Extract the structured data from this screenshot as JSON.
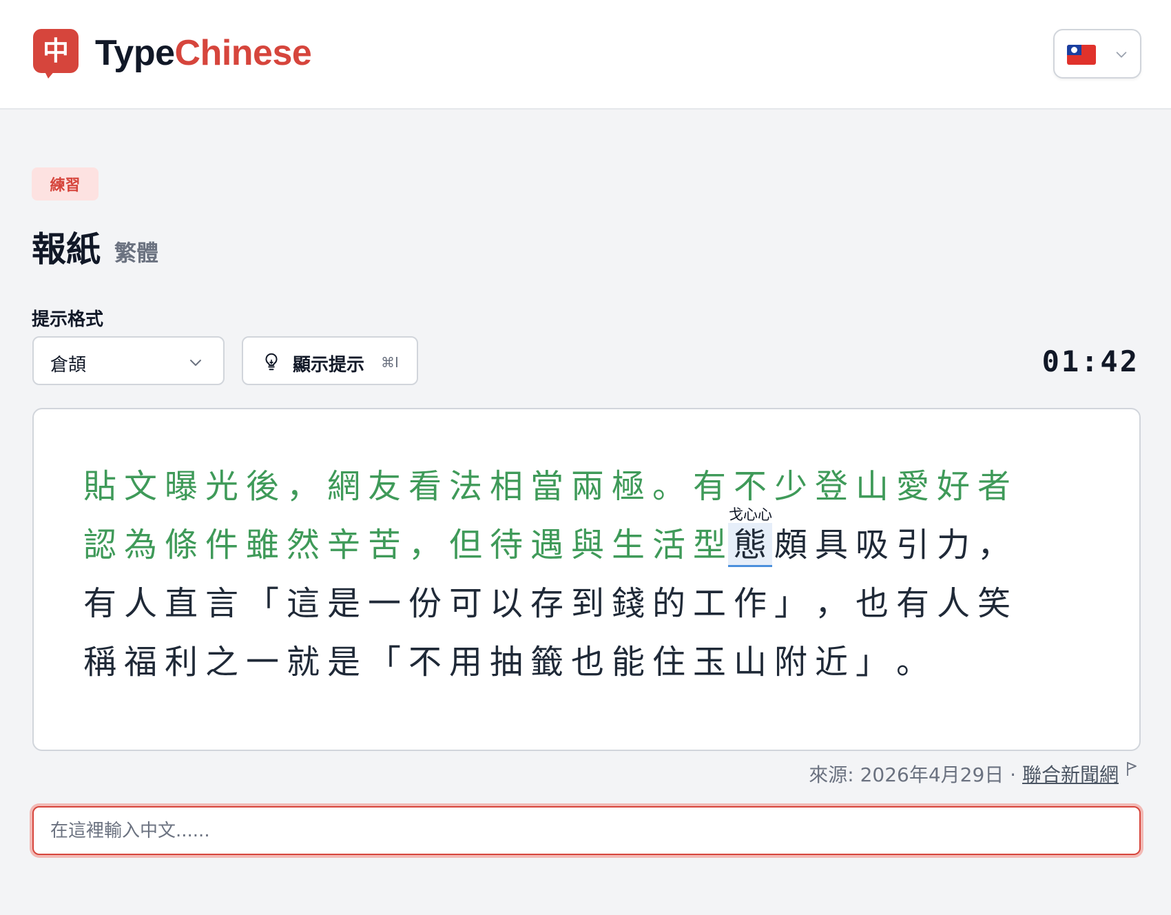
{
  "header": {
    "logo_glyph": "中",
    "brand_part1": "Type",
    "brand_part2": "Chinese",
    "colors": {
      "brand_red": "#d6453c",
      "dark": "#111827"
    },
    "language_selector": {
      "flag_icon": "taiwan-flag-icon",
      "chevron_icon": "chevron-down-icon"
    }
  },
  "main": {
    "badge": "練習",
    "title": "報紙",
    "subtitle": "繁體",
    "hint_format_label": "提示格式",
    "hint_format_select": {
      "value": "倉頡",
      "icon": "chevron-down-icon"
    },
    "show_hint_button": {
      "label": "顯示提示",
      "shortcut": "⌘I",
      "icon": "lightbulb-icon"
    },
    "timer": "01:42",
    "passage": {
      "colors": {
        "done": "#3f9a59",
        "todo": "#1f2937",
        "current_bg": "#e6eef9",
        "current_underline": "#4a8fdc"
      },
      "current_hint": "戈心心",
      "lines": [
        {
          "done": "貼文曝光後，網友看法相當兩極。有不少登山愛好者",
          "current": "",
          "todo": ""
        },
        {
          "done": "認為條件雖然辛苦，但待遇與生活型",
          "current": "態",
          "todo": "頗具吸引力，"
        },
        {
          "done": "",
          "current": "",
          "todo": "有人直言「這是一份可以存到錢的工作」，也有人笑"
        },
        {
          "done": "",
          "current": "",
          "todo": "稱福利之一就是「不用抽籤也能住玉山附近」。"
        }
      ]
    },
    "source": {
      "prefix": "來源: 2026年4月29日 · ",
      "link_text": "聯合新聞網",
      "flag_icon": "report-flag-icon"
    },
    "input": {
      "value": "",
      "placeholder": "在這裡輸入中文......"
    }
  }
}
